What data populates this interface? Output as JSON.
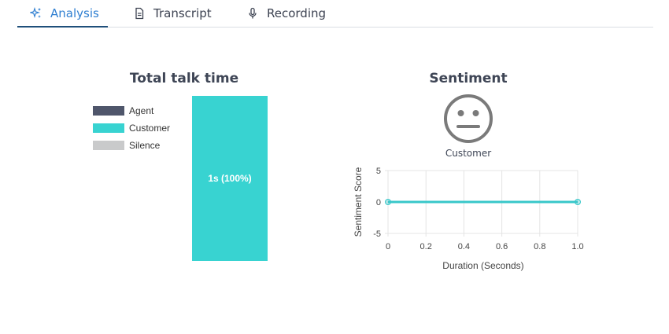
{
  "tabs": [
    {
      "label": "Analysis",
      "icon": "sparkle-icon",
      "active": true
    },
    {
      "label": "Transcript",
      "icon": "document-icon",
      "active": false
    },
    {
      "label": "Recording",
      "icon": "microphone-icon",
      "active": false
    }
  ],
  "talk_time": {
    "title": "Total talk time",
    "legend": [
      {
        "label": "Agent",
        "color": "#4f566b"
      },
      {
        "label": "Customer",
        "color": "#38d3d1"
      },
      {
        "label": "Silence",
        "color": "#c9cacb"
      }
    ],
    "bar_label": "1s (100%)"
  },
  "sentiment": {
    "title": "Sentiment",
    "face_icon": "neutral-face-icon",
    "speaker_label": "Customer"
  },
  "chart_data": {
    "type": "line",
    "xlabel": "Duration (Seconds)",
    "ylabel": "Sentiment Score",
    "xlim": [
      0,
      1.0
    ],
    "ylim": [
      -5,
      5
    ],
    "x_ticks": [
      "0",
      "0.2",
      "0.4",
      "0.6",
      "0.8",
      "1.0"
    ],
    "y_ticks": [
      "5",
      "0",
      "-5"
    ],
    "grid": true,
    "series": [
      {
        "x": [
          0,
          1.0
        ],
        "y": [
          0,
          0
        ],
        "color": "#38c7c9"
      }
    ]
  }
}
